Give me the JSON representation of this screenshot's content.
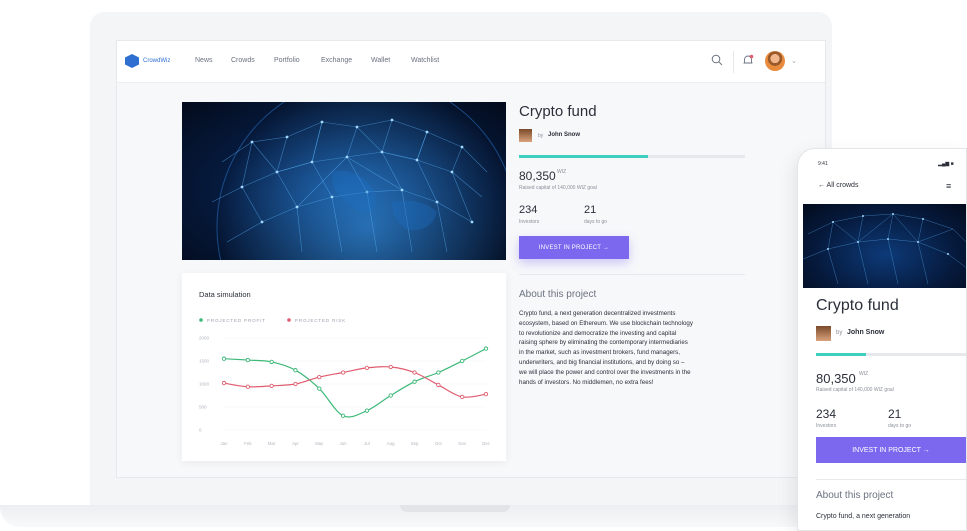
{
  "nav": {
    "logo_text": "CrowdWiz",
    "items": [
      "News",
      "Crowds",
      "Portfolio",
      "Exchange",
      "Wallet",
      "Watchlist"
    ]
  },
  "project": {
    "title": "Crypto fund",
    "by": "by",
    "author": "John Snow",
    "raised_fraction": 0.57,
    "raised": "80,350",
    "raised_unit": "WIZ",
    "raised_caption": "Raised capital of 140,000 WIZ goal",
    "investors_value": "234",
    "investors_label": "Investors",
    "days_value": "21",
    "days_label": "days to go",
    "invest_button": "INVEST IN PROJECT →",
    "about_title": "About this project",
    "about_lines": [
      "Crypto fund, a next generation decentralized investments",
      "ecosystem, based on Ethereum. We use blockchain technology",
      "to revolutionize and democratize the investing and capital",
      "raising sphere by eliminating the contemporary intermediaries",
      "in the market, such as investment brokers, fund managers,",
      "underwriters, and big financial institutions, and by doing so –",
      "we will place the power and control over the investments in the",
      "hands of investors. No middlemen, no extra fees!"
    ]
  },
  "chart_data": {
    "type": "line",
    "title": "Data simulation",
    "categories": [
      "Jan",
      "Feb",
      "Mar",
      "Apr",
      "May",
      "Jun",
      "Jul",
      "Aug",
      "Sep",
      "Oct",
      "Nov",
      "Dec"
    ],
    "series": [
      {
        "name": "PROJECTED PROFIT",
        "color": "#3cb878",
        "values": [
          1550,
          1520,
          1480,
          1300,
          900,
          310,
          420,
          750,
          1050,
          1250,
          1500,
          1770
        ]
      },
      {
        "name": "PROJECTED RISK",
        "color": "#e05c6f",
        "values": [
          1020,
          940,
          960,
          1000,
          1150,
          1250,
          1350,
          1370,
          1250,
          980,
          720,
          780
        ]
      }
    ],
    "yticks": [
      0,
      500,
      1000,
      1500,
      2000
    ],
    "ylim": [
      0,
      2000
    ],
    "grid": true,
    "legend": "top-left"
  },
  "phone": {
    "time": "9:41",
    "signal": "▂▄▆ ■",
    "back_label": "← All crowds",
    "menu_icon": "≡",
    "title": "Crypto fund",
    "by": "by",
    "author": "John Snow",
    "raised_fraction": 0.33,
    "raised": "80,350",
    "raised_unit": "WIZ",
    "raised_caption": "Raised capital of 140,000 WIZ goal",
    "investors_value": "234",
    "investors_label": "Investors",
    "days_value": "21",
    "days_label": "days to go",
    "invest_button": "INVEST IN PROJECT →",
    "about_title": "About this project",
    "about_text": "Crypto fund, a next generation"
  },
  "colors": {
    "accent": "#7b68ee",
    "progress": "#3ecfc1",
    "logo": "#2f6fd1"
  }
}
